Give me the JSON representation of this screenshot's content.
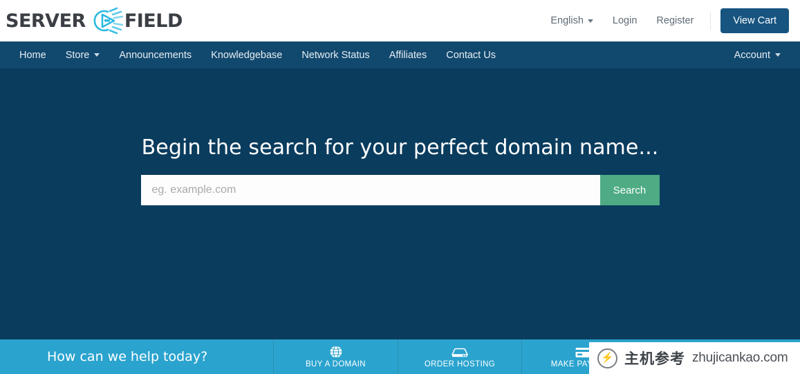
{
  "colors": {
    "nav_blue": "#11486e",
    "hero_navy": "#0a3c5e",
    "help_blue": "#2aa3ce",
    "search_green": "#4eab84",
    "cart_blue": "#175480",
    "logo_cyan": "#2bb9e0"
  },
  "header": {
    "logo": {
      "word_one": "SERVER",
      "word_two": "FIELD",
      "mark_name": "server-field-logo-mark"
    },
    "language": {
      "label": "English",
      "caret": "chevron-down-icon"
    },
    "login_label": "Login",
    "register_label": "Register",
    "cart_label": "View Cart"
  },
  "nav": {
    "left_items": [
      {
        "label": "Home",
        "has_caret": false
      },
      {
        "label": "Store",
        "has_caret": true
      },
      {
        "label": "Announcements",
        "has_caret": false
      },
      {
        "label": "Knowledgebase",
        "has_caret": false
      },
      {
        "label": "Network Status",
        "has_caret": false
      },
      {
        "label": "Affiliates",
        "has_caret": false
      },
      {
        "label": "Contact Us",
        "has_caret": false
      }
    ],
    "right_items": [
      {
        "label": "Account",
        "has_caret": true
      }
    ]
  },
  "hero": {
    "title": "Begin the search for your perfect domain name...",
    "search": {
      "value": "",
      "placeholder": "eg. example.com",
      "button_label": "Search"
    }
  },
  "helpbar": {
    "title": "How can we help today?",
    "cells": [
      {
        "label": "BUY A DOMAIN",
        "icon": "globe-icon"
      },
      {
        "label": "ORDER HOSTING",
        "icon": "server-icon"
      },
      {
        "label": "MAKE PAYMENT",
        "icon": "credit-card-icon"
      }
    ]
  },
  "watermark": {
    "cn": "主机参考",
    "en": "ZHUJICANKAO.COM",
    "bolt": "⚡"
  },
  "overlay_badge": {
    "cn": "主机参考",
    "domain": "zhujicankao.com",
    "bolt": "⚡"
  }
}
